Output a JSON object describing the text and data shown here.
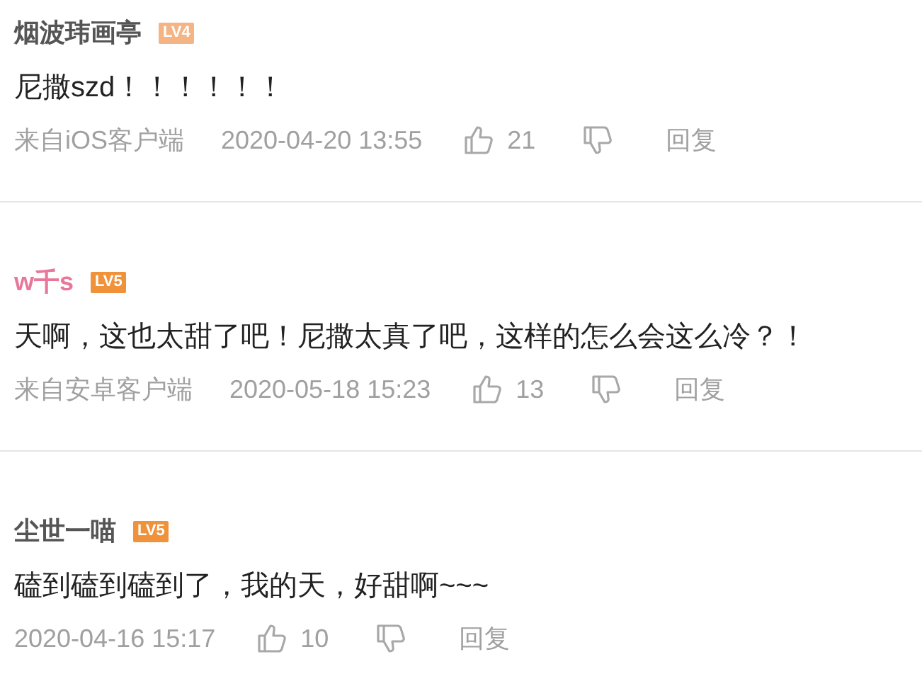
{
  "comments": [
    {
      "user": {
        "name": "烟波玮画亭",
        "color": "#555555"
      },
      "level": {
        "text": "LV4",
        "color": "#f4b483"
      },
      "body": "尼撒szd！！！！！！",
      "source": "来自iOS客户端",
      "time": "2020-04-20 13:55",
      "likes": "21",
      "reply": "回复"
    },
    {
      "user": {
        "name": "w千s",
        "color": "#e8779a"
      },
      "level": {
        "text": "LV5",
        "color": "#f0923a"
      },
      "body": "天啊，这也太甜了吧！尼撒太真了吧，这样的怎么会这么冷？！",
      "source": "来自安卓客户端",
      "time": "2020-05-18 15:23",
      "likes": "13",
      "reply": "回复"
    },
    {
      "user": {
        "name": "尘世一喵",
        "color": "#555555"
      },
      "level": {
        "text": "LV5",
        "color": "#f0923a"
      },
      "body": "磕到磕到磕到了，我的天，好甜啊~~~",
      "time": "2020-04-16 15:17",
      "likes": "10",
      "reply": "回复"
    }
  ]
}
